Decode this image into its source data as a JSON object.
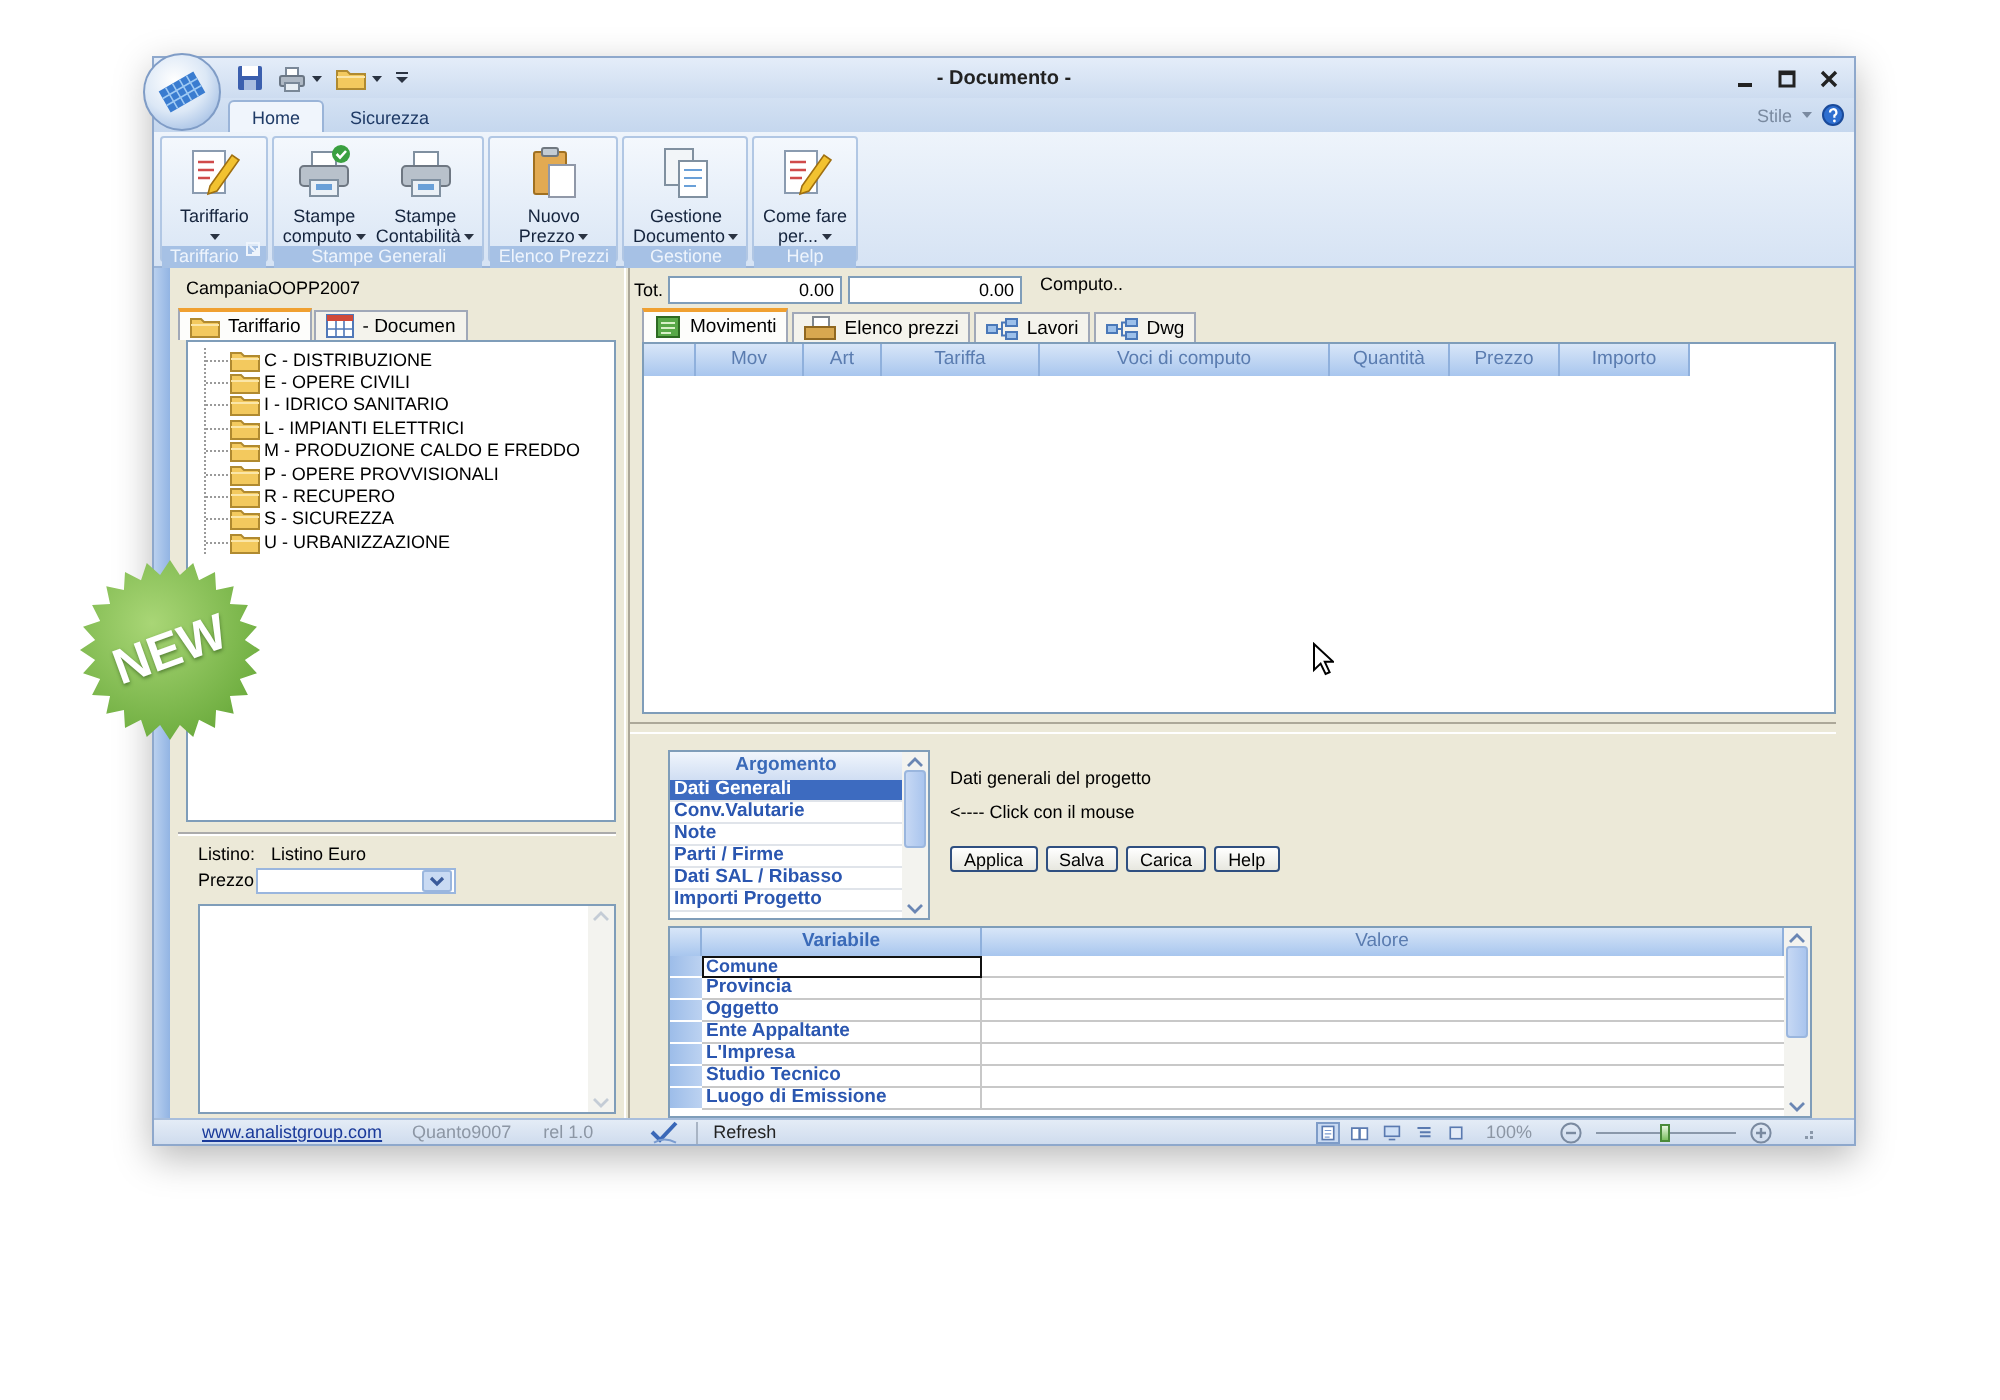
{
  "window": {
    "title": "- Documento -"
  },
  "badge": {
    "text": "NEW"
  },
  "ribbon": {
    "tabs": [
      {
        "label": "Home",
        "selected": true
      },
      {
        "label": "Sicurezza",
        "selected": false
      }
    ],
    "style_menu": {
      "label": "Stile"
    },
    "groups": [
      {
        "label": "Tariffario",
        "launcher": true,
        "buttons": [
          {
            "lines": [
              "Tariffario"
            ],
            "dropdown": true
          }
        ]
      },
      {
        "label": "Stampe Generali",
        "launcher": false,
        "buttons": [
          {
            "lines": [
              "Stampe",
              "computo"
            ],
            "dropdown": true
          },
          {
            "lines": [
              "Stampe",
              "Contabilità"
            ],
            "dropdown": true
          }
        ]
      },
      {
        "label": "Elenco Prezzi",
        "launcher": false,
        "buttons": [
          {
            "lines": [
              "Nuovo",
              "Prezzo"
            ],
            "dropdown": true
          }
        ]
      },
      {
        "label": "Gestione",
        "launcher": false,
        "buttons": [
          {
            "lines": [
              "Gestione",
              "Documento"
            ],
            "dropdown": true
          }
        ]
      },
      {
        "label": "Help",
        "launcher": false,
        "buttons": [
          {
            "lines": [
              "Come fare",
              "per..."
            ],
            "dropdown": true
          }
        ]
      }
    ]
  },
  "left_panel": {
    "title": "CampaniaOOPP2007",
    "tabs": [
      {
        "label": "Tariffario",
        "selected": true
      },
      {
        "label": "- Documen",
        "selected": false
      }
    ],
    "tree": [
      {
        "label": "C - DISTRIBUZIONE"
      },
      {
        "label": "E - OPERE CIVILI"
      },
      {
        "label": "I - IDRICO SANITARIO"
      },
      {
        "label": "L - IMPIANTI ELETTRICI"
      },
      {
        "label": "M - PRODUZIONE CALDO E FREDDO"
      },
      {
        "label": "P - OPERE PROVVISIONALI"
      },
      {
        "label": "R - RECUPERO"
      },
      {
        "label": "S - SICUREZZA"
      },
      {
        "label": "U - URBANIZZAZIONE"
      }
    ],
    "listino": {
      "label": "Listino:",
      "value": "Listino Euro"
    },
    "prezzo": {
      "label": "Prezzo"
    }
  },
  "computo": {
    "total_label": "Tot.",
    "totals": [
      "0.00",
      "0.00"
    ],
    "caption": "Computo..",
    "tabs": [
      {
        "label": "Movimenti",
        "selected": true
      },
      {
        "label": "Elenco prezzi",
        "selected": false
      },
      {
        "label": "Lavori",
        "selected": false
      },
      {
        "label": "Dwg",
        "selected": false
      }
    ],
    "columns": [
      "Mov",
      "Art",
      "Tariffa",
      "Voci di computo",
      "Quantità",
      "Prezzo",
      "Importo"
    ]
  },
  "dati": {
    "topics": {
      "header": "Argomento",
      "items": [
        {
          "label": "Dati Generali",
          "selected": true
        },
        {
          "label": "Conv.Valutarie",
          "selected": false
        },
        {
          "label": "Note",
          "selected": false
        },
        {
          "label": "Parti / Firme",
          "selected": false
        },
        {
          "label": "Dati SAL / Ribasso",
          "selected": false
        },
        {
          "label": "Importi Progetto",
          "selected": false
        }
      ]
    },
    "title": "Dati generali del progetto",
    "hint": "<---- Click con il mouse",
    "buttons": [
      "Applica",
      "Salva",
      "Carica",
      "Help"
    ],
    "variables": {
      "columns": [
        "Variabile",
        "Valore"
      ],
      "rows": [
        {
          "name": "Comune",
          "focused": true
        },
        {
          "name": "Provincia",
          "focused": false
        },
        {
          "name": "Oggetto",
          "focused": false
        },
        {
          "name": "Ente Appaltante",
          "focused": false
        },
        {
          "name": "L'Impresa",
          "focused": false
        },
        {
          "name": "Studio Tecnico",
          "focused": false
        },
        {
          "name": "Luogo di Emissione",
          "focused": false
        }
      ]
    }
  },
  "status_bar": {
    "link": "www.analistgroup.com",
    "fields": [
      "Quanto9007",
      "rel 1.0"
    ],
    "action": "Refresh",
    "views": [
      {
        "selected": true
      },
      {
        "selected": false
      },
      {
        "selected": false
      },
      {
        "selected": false
      },
      {
        "selected": false
      }
    ],
    "zoom": {
      "reading": "100%",
      "level": 0.48
    }
  }
}
